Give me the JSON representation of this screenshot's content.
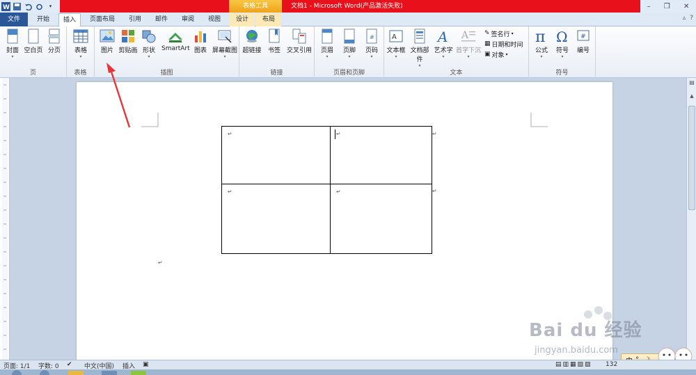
{
  "titlebar": {
    "context_group": "表格工具",
    "document_title": "文档1 - Microsoft Word(产品激活失败)"
  },
  "tabs": {
    "file": "文件",
    "home": "开始",
    "insert": "插入",
    "page_layout": "页面布局",
    "references": "引用",
    "mailings": "邮件",
    "review": "审阅",
    "view": "视图",
    "design": "设计",
    "layout": "布局"
  },
  "ribbon": {
    "pages": {
      "label": "页",
      "cover": "封面",
      "blank": "空白页",
      "break": "分页"
    },
    "tables": {
      "label": "表格",
      "table": "表格"
    },
    "illustrations": {
      "label": "插图",
      "picture": "图片",
      "clipart": "剪贴画",
      "shapes": "形状",
      "smartart": "SmartArt",
      "chart": "图表",
      "screenshot": "屏幕截图"
    },
    "links": {
      "label": "链接",
      "hyperlink": "超链接",
      "bookmark": "书签",
      "crossref": "交叉引用"
    },
    "header_footer": {
      "label": "页眉和页脚",
      "header": "页眉",
      "footer": "页脚",
      "page_number": "页码"
    },
    "text": {
      "label": "文本",
      "textbox": "文本框",
      "quickparts": "文档部件",
      "wordart": "艺术字",
      "dropcap": "首字下沉",
      "signature": "签名行",
      "datetime": "日期和时间",
      "object": "对象"
    },
    "symbols": {
      "label": "符号",
      "equation": "公式",
      "symbol": "符号",
      "number": "编号"
    }
  },
  "statusbar": {
    "page": "页面: 1/1",
    "words": "字数: 0",
    "language": "中文(中国)",
    "mode": "插入",
    "zoom": "132"
  },
  "table": {
    "rows": 2,
    "cols": 2
  },
  "watermark": {
    "brand": "Bai du 经验",
    "url": "jingyan.baidu.com"
  },
  "ime": {
    "label": "中"
  },
  "colors": {
    "accent": "#2b5797",
    "titlebar_red": "#e8101a",
    "context_tab": "#f0a21c",
    "arrow": "#e8353a"
  }
}
